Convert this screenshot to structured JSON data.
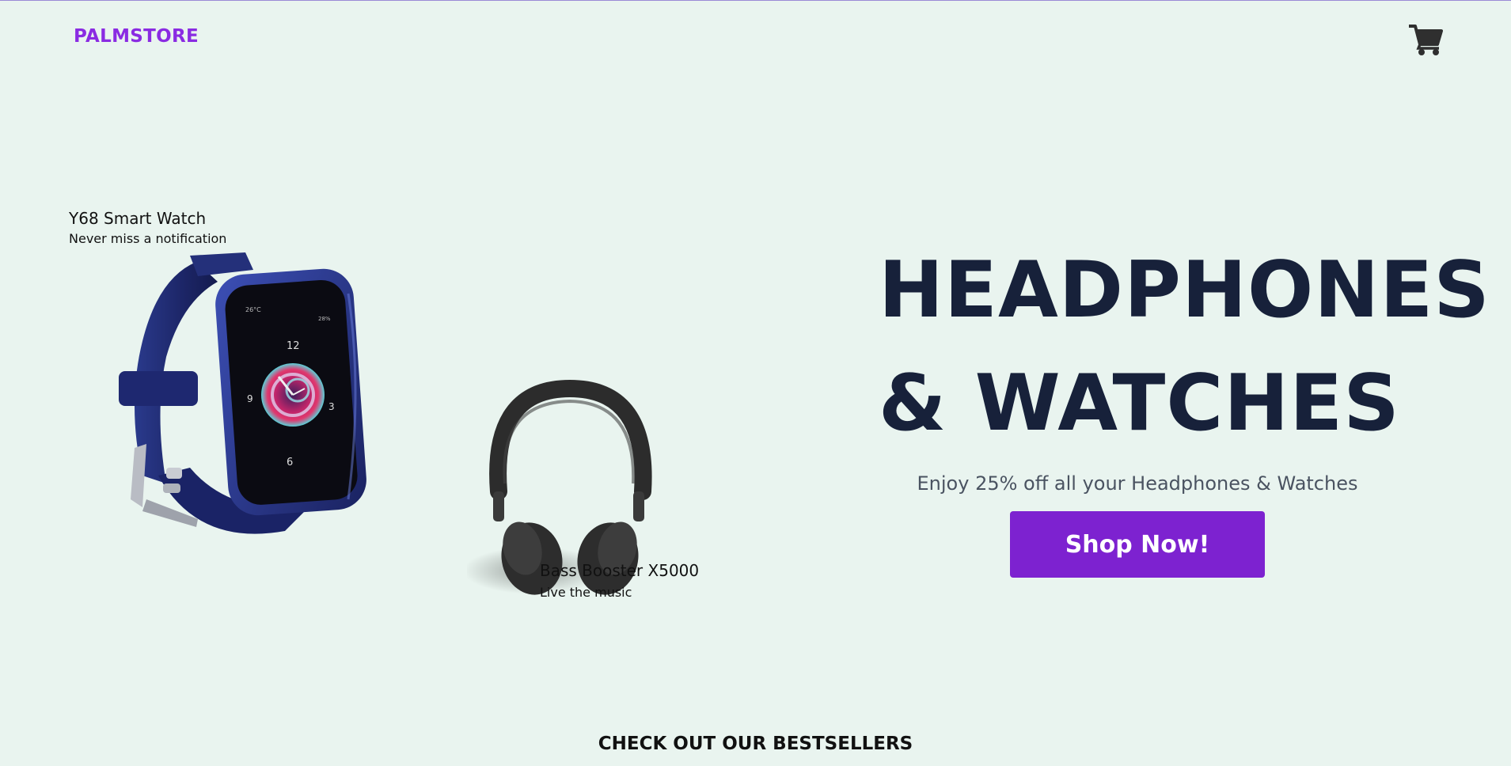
{
  "header": {
    "brand": "PALMSTORE",
    "cart_icon": "shopping-cart-icon"
  },
  "products": [
    {
      "name": "Y68 Smart Watch",
      "tagline": "Never miss a notification",
      "image": "smart-watch-image"
    },
    {
      "name": "Bass Booster X5000",
      "tagline": "Live the music",
      "image": "headphones-image"
    }
  ],
  "watch_face": {
    "temperature": "26°C",
    "battery": "28%",
    "numbers": [
      "12",
      "3",
      "6",
      "9"
    ]
  },
  "hero": {
    "title_line1": "HEADPHONES",
    "title_line2": "& WATCHES",
    "subtitle": "Enjoy 25% off all your Headphones & Watches",
    "cta": "Shop Now!"
  },
  "section": {
    "bestsellers_heading": "CHECK OUT OUR BESTSELLERS"
  },
  "colors": {
    "background": "#e9f4ef",
    "brand": "#8a2be2",
    "button": "#7d22d0",
    "title": "#17213a"
  }
}
